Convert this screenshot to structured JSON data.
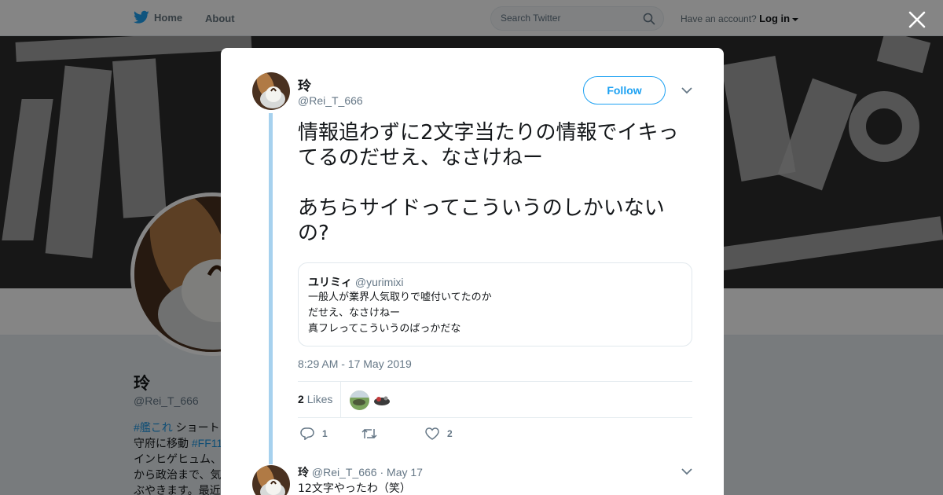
{
  "nav": {
    "home_label": "Home",
    "about_label": "About",
    "search_placeholder": "Search Twitter",
    "account_prompt": "Have an account?",
    "login_label": "Log in"
  },
  "profile": {
    "name": "玲",
    "handle": "@Rei_T_666",
    "bio_lines": [
      {
        "tag": "#艦これ",
        "text": " ショート"
      },
      {
        "tag": "",
        "text": "守府に移動 "
      },
      {
        "tag": "",
        "text": "インヒゲヒュム、"
      },
      {
        "tag": "",
        "text": "から政治まで、気"
      },
      {
        "tag": "",
        "text": "ぶやきます。最近"
      }
    ],
    "bio_tag2": "#FF11"
  },
  "tweet": {
    "author_name": "玲",
    "author_handle": "@Rei_T_666",
    "follow_label": "Follow",
    "text": "情報追わずに2文字当たりの情報でイキってるのだせえ、なさけねー\n\nあちらサイドってこういうのしかいないの?",
    "quote": {
      "name": "ユリミィ",
      "handle": "@yurimixi",
      "text": "一般人が業界人気取りで嘘付いてたのか\nだせえ、なさけねー\n真フレってこういうのばっかだな"
    },
    "timestamp": "8:29 AM - 17 May 2019",
    "likes_count": "2",
    "likes_label": "Likes",
    "reply_count": "1",
    "retweet_count": "",
    "like_count": "2"
  },
  "reply": {
    "name": "玲",
    "handle": "@Rei_T_666",
    "date": "· May 17",
    "text": "12文字やったわ（笑）"
  },
  "colors": {
    "accent": "#1da1f2",
    "thread_line": "#a6d1ee",
    "overlay": "rgba(0,0,0,0.48)"
  }
}
